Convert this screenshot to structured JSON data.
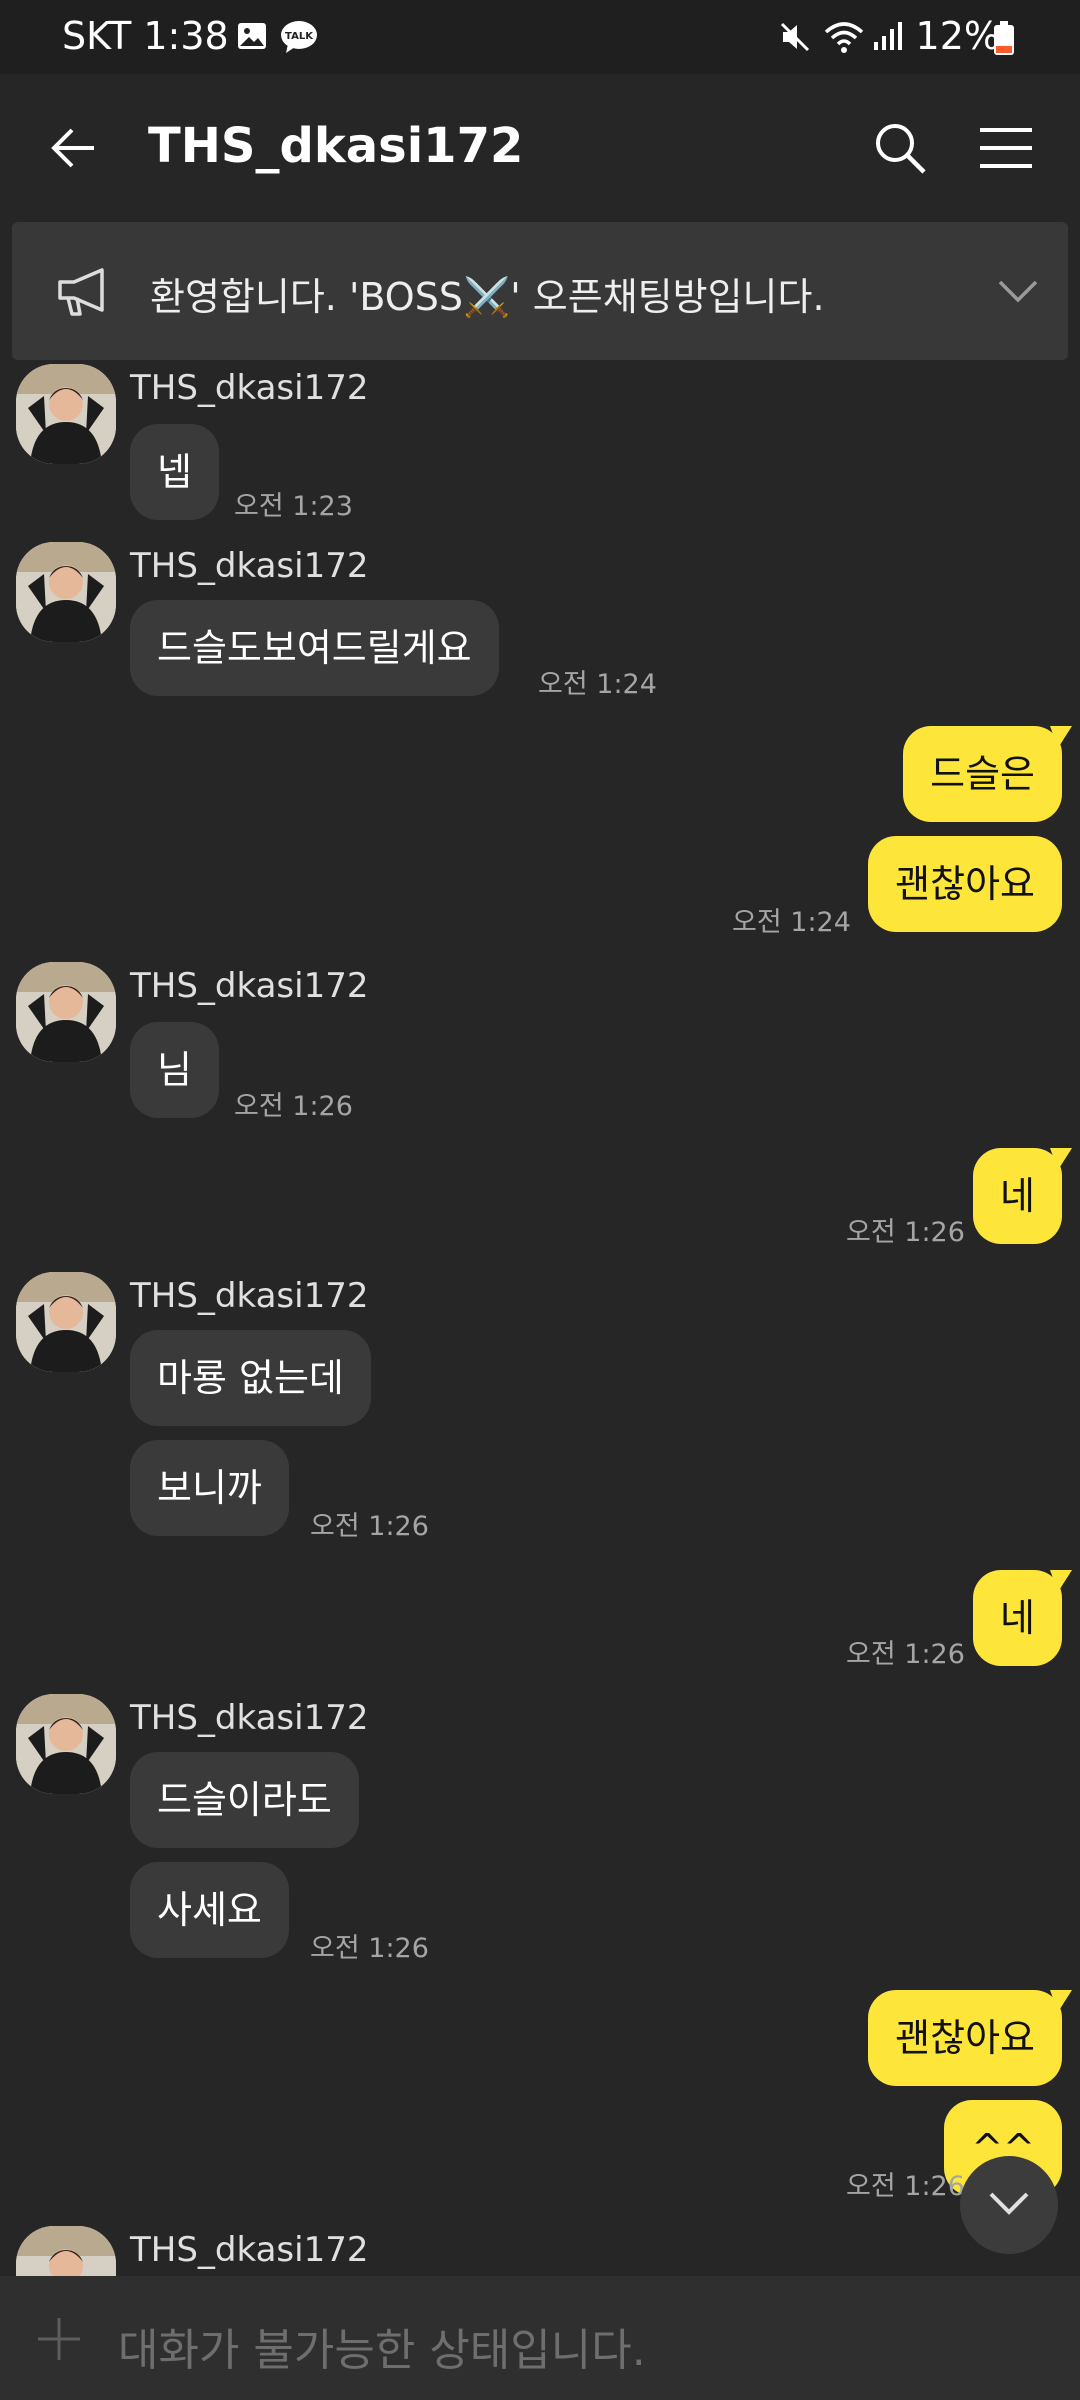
{
  "status_bar": {
    "time": "SKT 1:38",
    "battery": "12%",
    "icons": [
      "gallery-icon",
      "kakaotalk-icon",
      "mute-icon",
      "wifi-icon",
      "signal-icon",
      "battery-icon"
    ]
  },
  "header": {
    "title": "THS_dkasi172",
    "icons": [
      "back-arrow-icon",
      "search-icon",
      "menu-icon"
    ]
  },
  "notice": {
    "text": "환영합니다. 'BOSS⚔️' 오픈채팅방입니다."
  },
  "messages": {
    "m1": {
      "sender": "THS_dkasi172",
      "bubbles": [
        "넵"
      ],
      "time": "오전 1:23"
    },
    "m2": {
      "sender": "THS_dkasi172",
      "bubbles": [
        "드슬도보여드릴게요"
      ],
      "time": "오전 1:24"
    },
    "m3": {
      "bubbles": [
        "드슬은",
        "괜찮아요"
      ],
      "time": "오전 1:24"
    },
    "m4": {
      "sender": "THS_dkasi172",
      "bubbles": [
        "님"
      ],
      "time": "오전 1:26"
    },
    "m5": {
      "bubbles": [
        "네"
      ],
      "time": "오전 1:26"
    },
    "m6": {
      "sender": "THS_dkasi172",
      "bubbles": [
        "마룡 없는데",
        "보니까"
      ],
      "time": "오전 1:26"
    },
    "m7": {
      "bubbles": [
        "네"
      ],
      "time": "오전 1:26"
    },
    "m8": {
      "sender": "THS_dkasi172",
      "bubbles": [
        "드슬이라도",
        "사세요"
      ],
      "time": "오전 1:26"
    },
    "m9": {
      "bubbles": [
        "괜찮아요",
        "^^"
      ],
      "time": "오전 1:26"
    },
    "m10": {
      "sender": "THS_dkasi172"
    }
  },
  "input": {
    "placeholder": "대화가 불가능한 상태입니다."
  },
  "colors": {
    "background": "#262626",
    "incoming_bubble": "#3a3a3a",
    "outgoing_bubble": "#fde53a"
  }
}
